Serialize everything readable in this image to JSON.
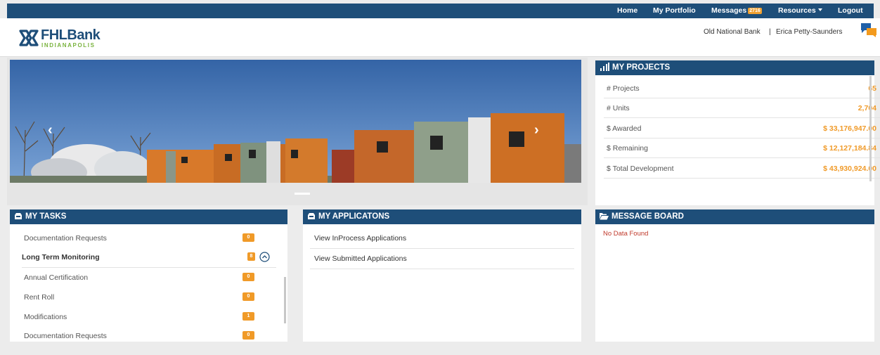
{
  "nav": {
    "home": "Home",
    "portfolio": "My Portfolio",
    "messages": "Messages",
    "messages_count": "2716",
    "resources": "Resources",
    "logout": "Logout"
  },
  "header": {
    "logo_main": "FHLBank",
    "logo_sub": "INDIANAPOLIS",
    "bank": "Old National Bank",
    "separator": "|",
    "user": "Erica Petty-Saunders"
  },
  "projects": {
    "title": "MY PROJECTS",
    "rows": [
      {
        "label": "# Projects",
        "value": "65"
      },
      {
        "label": "# Units",
        "value": "2,704"
      },
      {
        "label": "$ Awarded",
        "value": "$ 33,176,947.00"
      },
      {
        "label": "$ Remaining",
        "value": "$ 12,127,184.84"
      },
      {
        "label": "$ Total Development",
        "value": "$ 43,930,924.00"
      }
    ]
  },
  "tasks": {
    "title": "MY TASKS",
    "items": [
      {
        "label": "Documentation Requests",
        "count": "0"
      },
      {
        "label": "Long Term Monitoring",
        "count": "8"
      },
      {
        "label": "Annual Certification",
        "count": "0"
      },
      {
        "label": "Rent Roll",
        "count": "0"
      },
      {
        "label": "Modifications",
        "count": "1"
      },
      {
        "label": "Documentation Requests",
        "count": "0"
      }
    ]
  },
  "applications": {
    "title": "MY APPLICATONS",
    "items": [
      "View InProcess Applications",
      "View Submitted Applications"
    ]
  },
  "message_board": {
    "title": "MESSAGE BOARD",
    "empty": "No Data Found"
  },
  "colors": {
    "nav": "#1e4e79",
    "accent": "#f09a28",
    "error": "#c0392b"
  }
}
